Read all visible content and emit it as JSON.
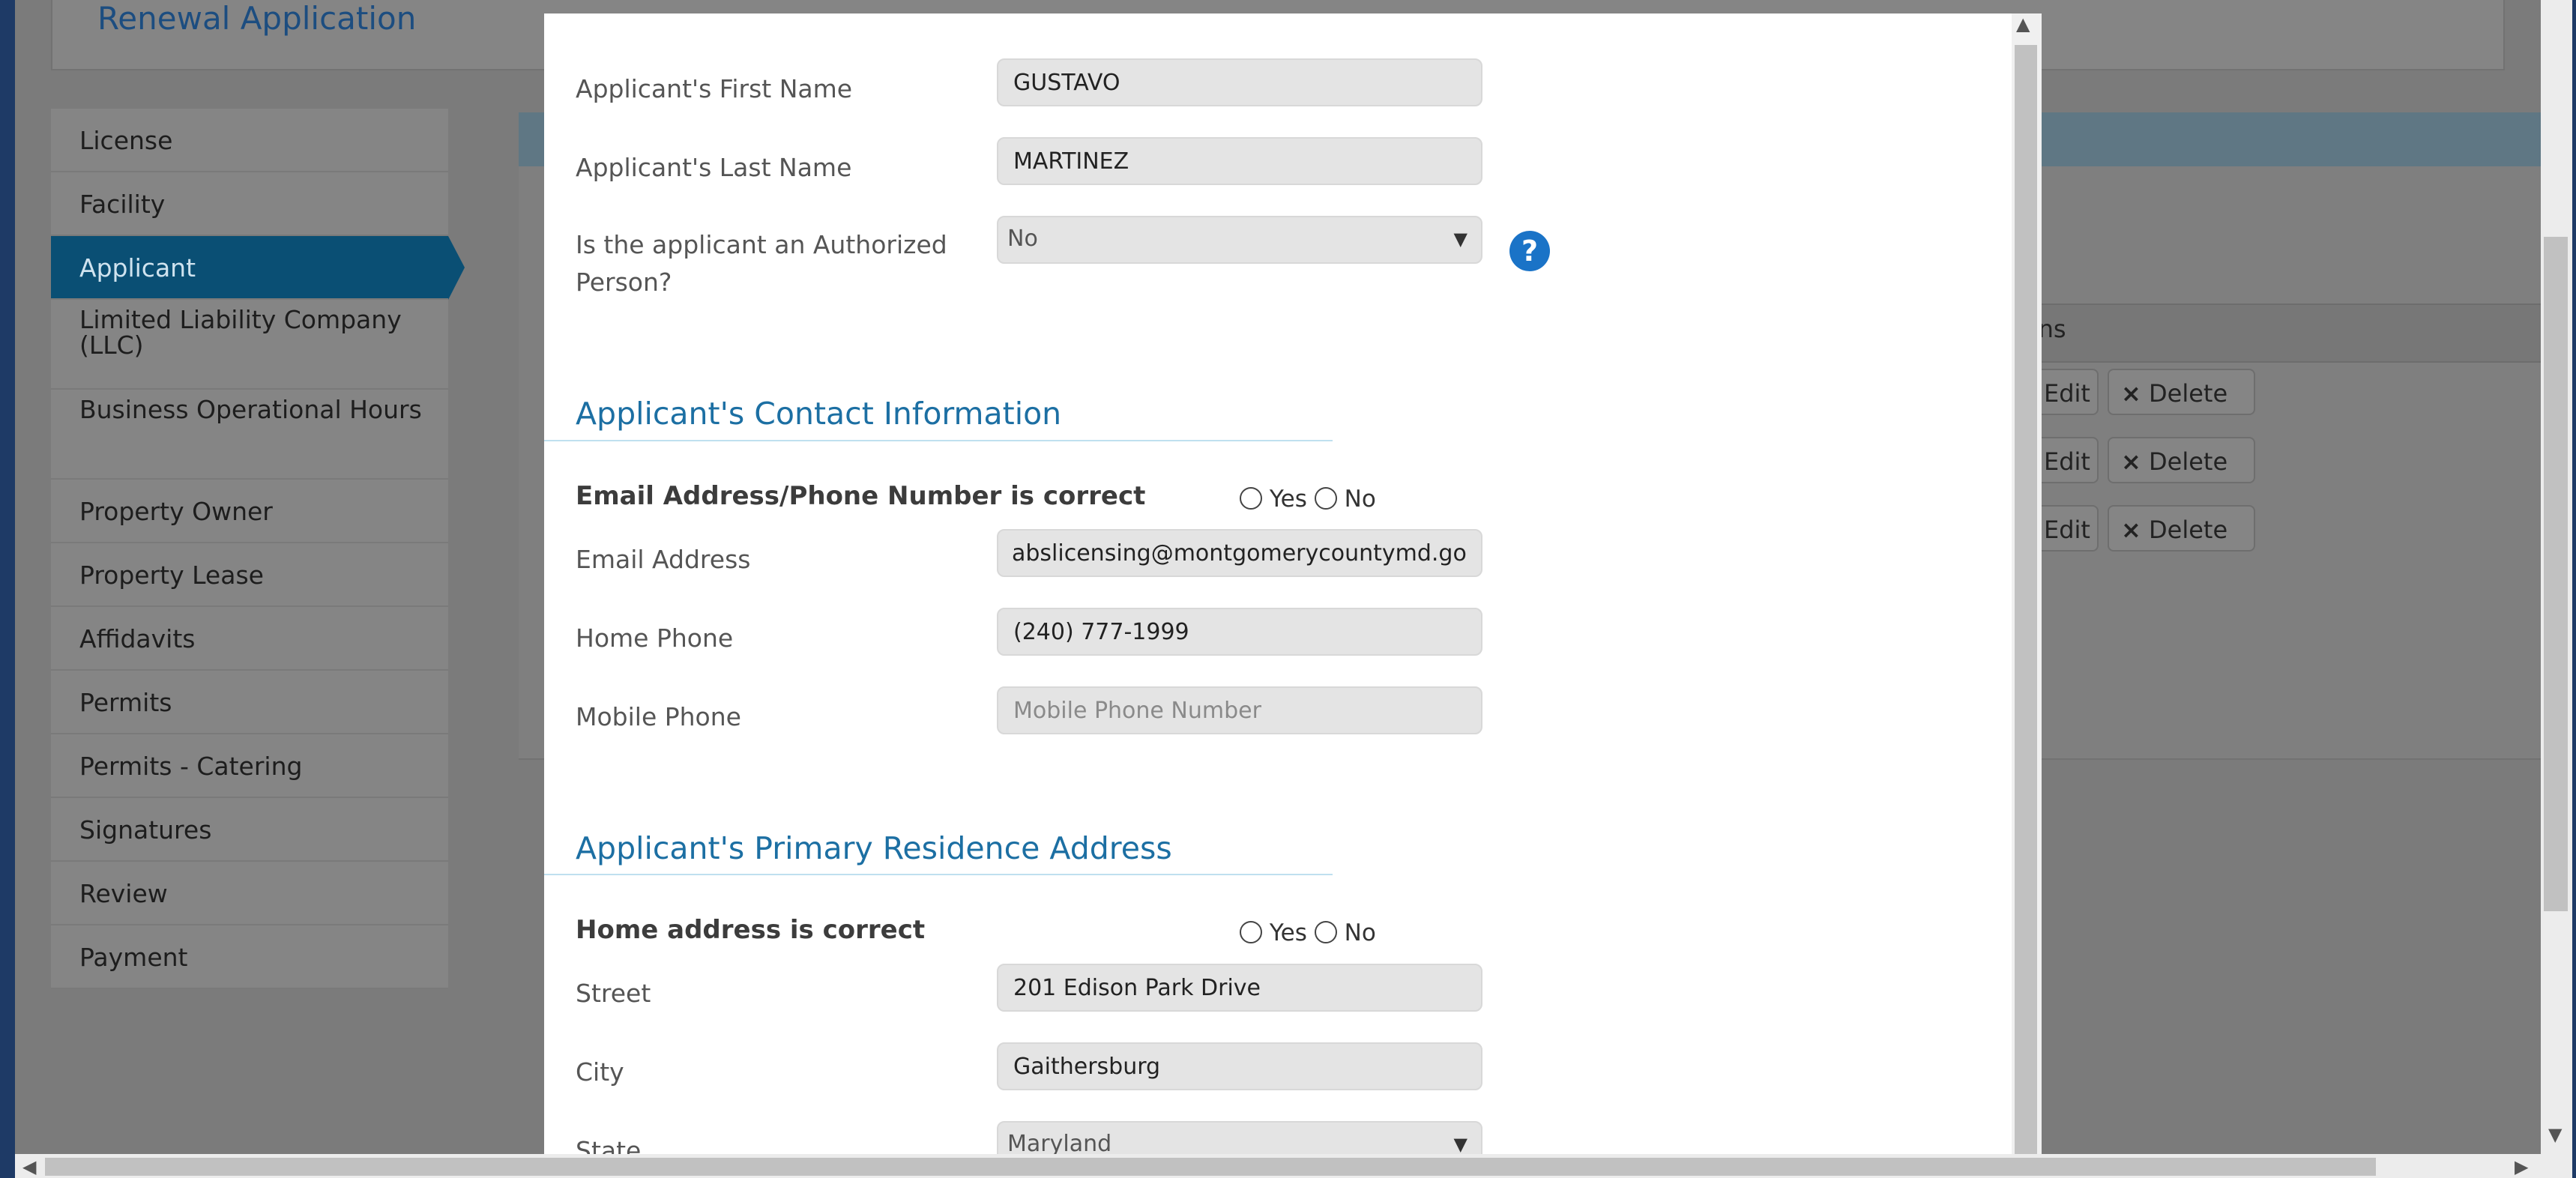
{
  "background": {
    "title": "Renewal Application",
    "nav": [
      {
        "label": "License",
        "active": false
      },
      {
        "label": "Facility",
        "active": false
      },
      {
        "label": "Applicant",
        "active": true
      },
      {
        "label": "Limited Liability Company (LLC)",
        "active": false
      },
      {
        "label": "Business Operational Hours",
        "active": false
      },
      {
        "label": "Property Owner",
        "active": false
      },
      {
        "label": "Property Lease",
        "active": false
      },
      {
        "label": "Affidavits",
        "active": false
      },
      {
        "label": "Permits",
        "active": false
      },
      {
        "label": "Permits - Catering",
        "active": false
      },
      {
        "label": "Signatures",
        "active": false
      },
      {
        "label": "Review",
        "active": false
      },
      {
        "label": "Payment",
        "active": false
      }
    ],
    "table_header_fragment": "ons",
    "edit_label": "Edit",
    "delete_label": "Delete",
    "delete_icon": "×"
  },
  "modal": {
    "first_name": {
      "label": "Applicant's First Name",
      "value": "GUSTAVO"
    },
    "last_name": {
      "label": "Applicant's Last Name",
      "value": "MARTINEZ"
    },
    "authorized": {
      "label": "Is the applicant an Authorized Person?",
      "value": "No",
      "help_icon": "?"
    },
    "contact": {
      "heading": "Applicant's Contact Information",
      "confirm_label": "Email Address/Phone Number is correct",
      "yes": "Yes",
      "no": "No",
      "email": {
        "label": "Email Address",
        "value": "abslicensing@montgomerycountymd.go"
      },
      "home_phone": {
        "label": "Home Phone",
        "value": "(240) 777-1999"
      },
      "mobile_phone": {
        "label": "Mobile Phone",
        "value": "",
        "placeholder": "Mobile Phone Number"
      }
    },
    "residence": {
      "heading": "Applicant's Primary Residence Address",
      "confirm_label": "Home address is correct",
      "yes": "Yes",
      "no": "No",
      "street": {
        "label": "Street",
        "value": "201 Edison Park Drive"
      },
      "city": {
        "label": "City",
        "value": "Gaithersburg"
      },
      "state": {
        "label": "State",
        "value": "Maryland"
      }
    }
  }
}
